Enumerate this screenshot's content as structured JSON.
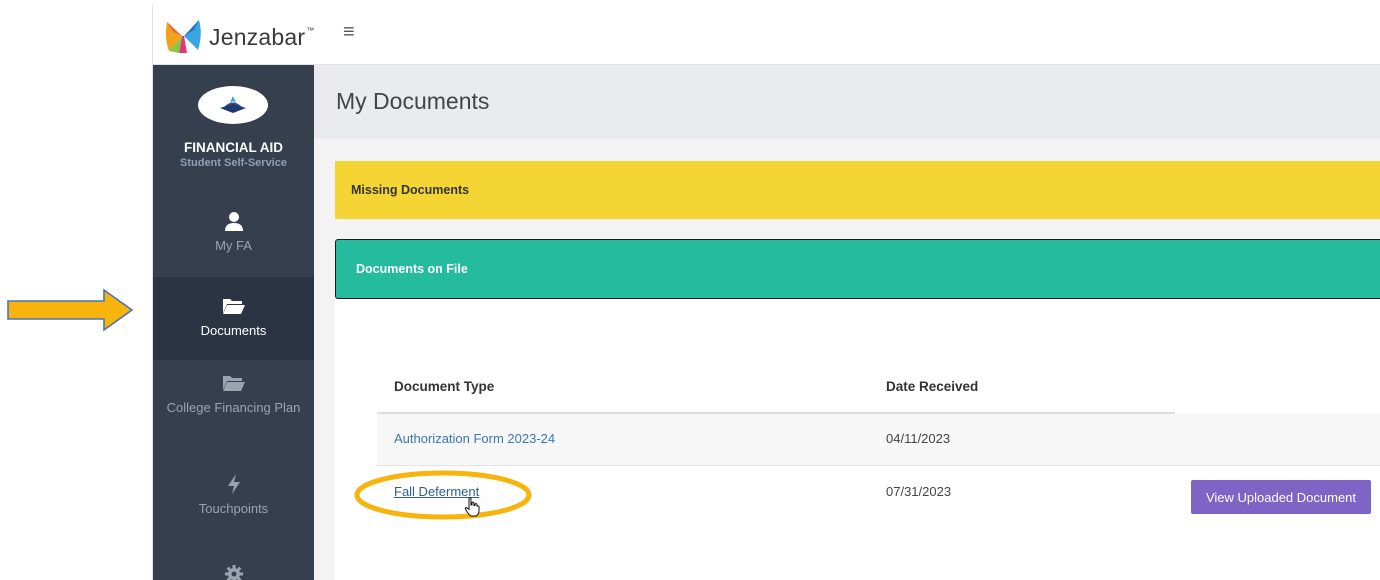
{
  "brand": {
    "name": "Jenzabar",
    "trademark": "™"
  },
  "sidebar": {
    "title": "FINANCIAL AID",
    "subtitle": "Student Self-Service",
    "items": [
      {
        "label": "My FA",
        "icon": "user-icon"
      },
      {
        "label": "Documents",
        "icon": "folder-open-icon",
        "active": true
      },
      {
        "label": "College Financing Plan",
        "icon": "folder-open-icon"
      },
      {
        "label": "Touchpoints",
        "icon": "bolt-icon"
      },
      {
        "label": "",
        "icon": "gear-icon"
      }
    ]
  },
  "main": {
    "page_title": "My Documents",
    "missing_documents_label": "Missing Documents",
    "documents_on_file_label": "Documents on File",
    "table": {
      "headers": [
        "Document Type",
        "Date Received"
      ],
      "rows": [
        {
          "document_type": "Authorization Form 2023-24",
          "date_received": "04/11/2023"
        },
        {
          "document_type": "Fall Deferment",
          "date_received": "07/31/2023",
          "action_label": "View Uploaded Document"
        }
      ]
    }
  },
  "colors": {
    "sidebar_bg": "#353f4e",
    "missing_bar": "#f5d533",
    "on_file_bar": "#24bb9f",
    "button": "#7e64c4",
    "annotation": "#f6b40c"
  }
}
